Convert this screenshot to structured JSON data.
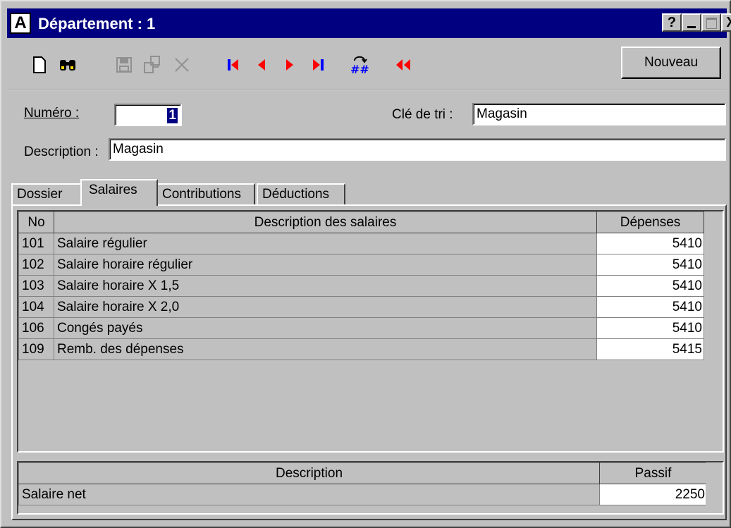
{
  "window": {
    "app_icon_letter": "A",
    "title": "Département : 1",
    "buttons": {
      "help": "?",
      "minimize": "_",
      "maximize": "□",
      "close": "X"
    }
  },
  "toolbar": {
    "new_button_label": "Nouveau",
    "icons": [
      "new-document-icon",
      "binoculars-find-icon",
      "save-icon",
      "copy-icon",
      "delete-icon",
      "first-record-icon",
      "previous-record-icon",
      "next-record-icon",
      "last-record-icon",
      "renumber-icon",
      "rewind-icon"
    ]
  },
  "form": {
    "numero_label": "Numéro :",
    "numero_value": "1",
    "cle_tri_label": "Clé de tri :",
    "cle_tri_value": "Magasin",
    "description_label": "Description :",
    "description_value": "Magasin"
  },
  "tabs": [
    {
      "label": "Dossier",
      "active": false
    },
    {
      "label": "Salaires",
      "active": true
    },
    {
      "label": "Contributions",
      "active": false
    },
    {
      "label": "Déductions",
      "active": false
    }
  ],
  "salaries_grid": {
    "columns": [
      "No",
      "Description des salaires",
      "Dépenses"
    ],
    "rows": [
      {
        "no": "101",
        "description": "Salaire régulier",
        "depenses": "5410"
      },
      {
        "no": "102",
        "description": "Salaire horaire régulier",
        "depenses": "5410"
      },
      {
        "no": "103",
        "description": "Salaire horaire X 1,5",
        "depenses": "5410"
      },
      {
        "no": "104",
        "description": "Salaire horaire X 2,0",
        "depenses": "5410"
      },
      {
        "no": "106",
        "description": "Congés payés",
        "depenses": "5410"
      },
      {
        "no": "109",
        "description": "Remb. des dépenses",
        "depenses": "5415"
      }
    ]
  },
  "liability_grid": {
    "columns": [
      "Description",
      "Passif"
    ],
    "rows": [
      {
        "description": "Salaire net",
        "passif": "2250"
      }
    ]
  },
  "colors": {
    "titlebar": "#000080",
    "face": "#c0c0c0",
    "nav_red": "#ff0000",
    "nav_blue": "#0000ff"
  }
}
